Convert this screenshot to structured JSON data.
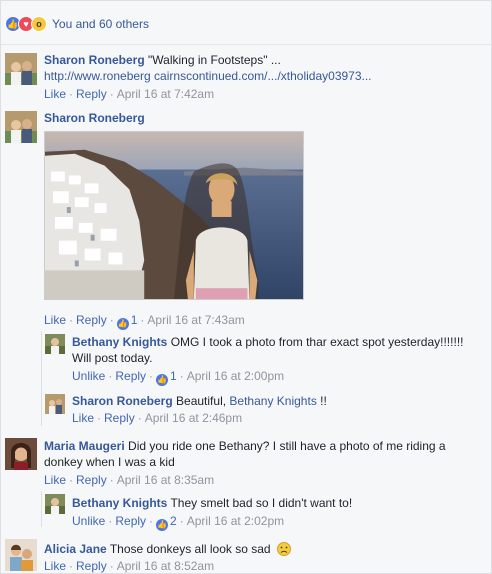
{
  "reactions": {
    "summary": "You and 60 others"
  },
  "actions": {
    "like": "Like",
    "unlike": "Unlike",
    "reply": "Reply",
    "sep": "·"
  },
  "comments": [
    {
      "author": "Sharon Roneberg",
      "text": "\"Walking in Footsteps\" ...",
      "link": "http://www.roneberg cairnscontinued.com/.../xtholiday03973...",
      "time": "April 16 at 7:42am",
      "like_label": "Like"
    },
    {
      "author": "Sharon Roneberg",
      "time": "April 16 at 7:43am",
      "likes": "1",
      "like_label": "Like"
    },
    {
      "author": "Bethany Knights",
      "text_line1": "OMG I took a photo from thar exact spot yesterday!!!!!!!",
      "text_line2": "Will post today.",
      "time": "April 16 at 2:00pm",
      "likes": "1",
      "like_label": "Unlike"
    },
    {
      "author": "Sharon Roneberg",
      "text": "Beautiful,",
      "mention": "Bethany Knights",
      "suffix": "!!",
      "time": "April 16 at 2:46pm",
      "like_label": "Like"
    },
    {
      "author": "Maria Maugeri",
      "text_line1": "Did you ride one Bethany? I still have a photo of me riding a",
      "text_line2": "donkey when I was a kid",
      "time": "April 16 at 8:35am",
      "like_label": "Like"
    },
    {
      "author": "Bethany Knights",
      "text": "They smelt bad so I didn't want to!",
      "time": "April 16 at 2:02pm",
      "likes": "2",
      "like_label": "Unlike"
    },
    {
      "author": "Alicia Jane",
      "text": "Those donkeys all look so sad",
      "time": "April 16 at 8:52am",
      "like_label": "Like"
    }
  ],
  "icons": {
    "like": "like-reaction-icon",
    "love": "love-reaction-icon",
    "wow": "wow-reaction-icon",
    "sad_emoji": "sad-face-emoji-icon"
  },
  "colors": {
    "link": "#365899",
    "action": "#4267b2",
    "muted": "#90949c",
    "like_blue": "#4a76e8"
  }
}
